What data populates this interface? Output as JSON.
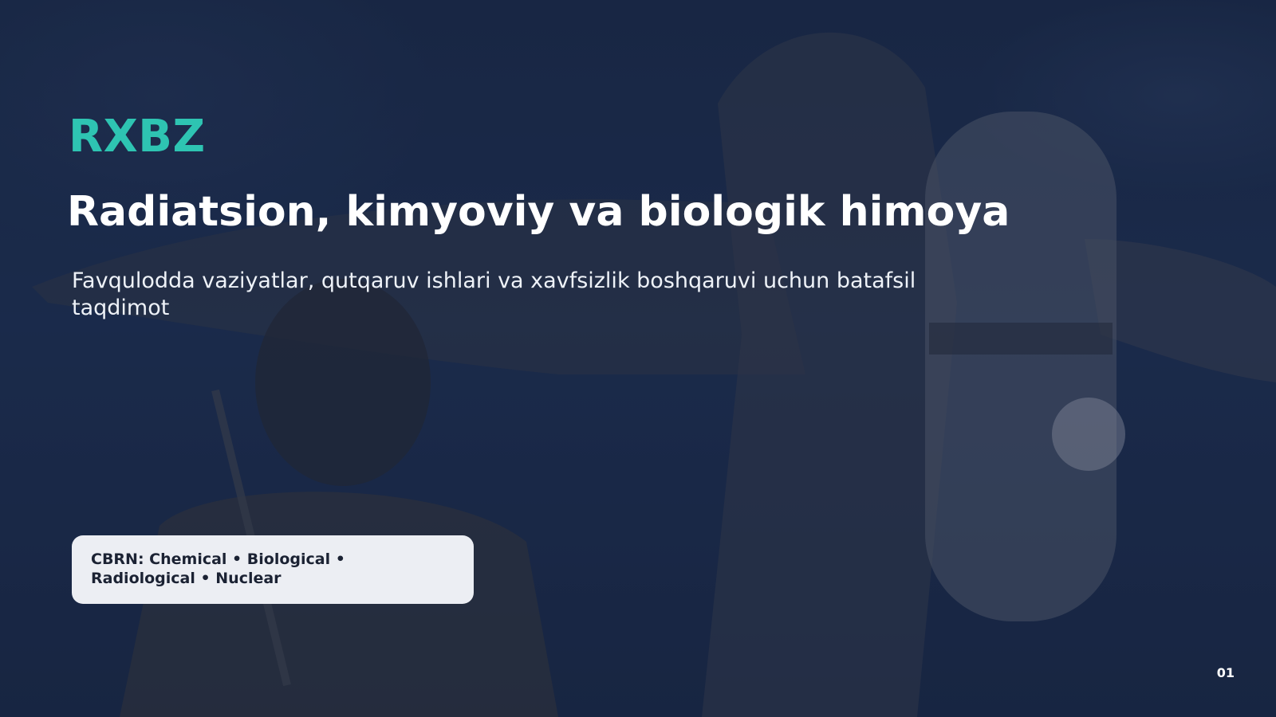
{
  "slide": {
    "kicker": "RXBZ",
    "title": "Radiatsion, kimyoviy va biologik himoya",
    "subtitle": "Favqulodda vaziyatlar, qutqaruv ishlari va xavfsizlik boshqaruvi uchun batafsil taqdimot",
    "badge": "CBRN: Chemical • Biological • Radiological • Nuclear",
    "page_number": "01"
  },
  "colors": {
    "accent": "#2ec4b2",
    "background": "#1c2d4c",
    "badge_background": "#eceef3",
    "badge_text": "#1b2233"
  }
}
